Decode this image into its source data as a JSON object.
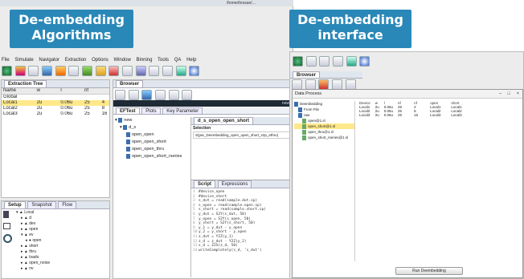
{
  "callouts": {
    "algorithms": "De-embedding\nAlgorithms",
    "interface": "De-embedding\ninterface"
  },
  "window": {
    "title_path": "/home/tnosan/..."
  },
  "menubar": [
    "File",
    "Simulate",
    "Navigator",
    "Extraction",
    "Options",
    "Window",
    "Binning",
    "Tools",
    "QA",
    "Help"
  ],
  "extraction_tree": {
    "tab": "Extraction Tree",
    "columns": [
      "Name",
      "w",
      "l",
      "nf"
    ],
    "rows": [
      [
        "Global",
        "",
        "",
        ""
      ],
      [
        "Local1",
        "2u",
        "0.06u",
        "25"
      ],
      [
        "Local2",
        "2u",
        "0.06u",
        "25"
      ],
      [
        "Local3",
        "2u",
        "0.06u",
        "25"
      ]
    ],
    "extra": [
      "4",
      "8",
      "16"
    ]
  },
  "browser": {
    "tab": "Browser",
    "subtabs": [
      "EFTest",
      "Plots",
      "Key Parameter"
    ],
    "new_label": "new",
    "tree_root": "new",
    "tree_folder": "d_s",
    "tree_items": [
      "open_open",
      "open_open_short",
      "open_open_thru",
      "open_open_short_rseries"
    ],
    "editor_tab": "d_s_open_open_short",
    "selection_label": "Selection",
    "selection_value": "S(par_Deembedding_open_open_short_s2p_ethru)"
  },
  "script": {
    "tabs": [
      "Script",
      "Expressions"
    ],
    "lines": [
      "#device_open",
      "#device_short",
      "s_dut = read(sample.dut.sp)",
      "s_open = read(sample.open.sp)",
      "s_short = read(sample.short.sp)",
      "y_dut = S2Y(s_dut, 50)",
      "y_open = S2Y(s_open, 50)",
      "y_short = S2Y(s_short, 50)",
      "y_1 = y_dut - y_open",
      "y_2 = y_short - y_open",
      "z_dut = Y2Z(y_1)",
      "z_d = z_dut - Y2Z(y_2)",
      "s_d = Z2S(z_d, 50)",
      "writeCompletely(s_d, 's_dut')"
    ]
  },
  "bottom_left": {
    "tabs": [
      "Setup",
      "Snapshot",
      "Flow"
    ],
    "tree": [
      "Local",
      "d",
      "dev",
      "open",
      "ev",
      "open",
      "short",
      "thru",
      "loads",
      "open_noise",
      "nv"
    ]
  },
  "right_app": {
    "browser_tab": "Browser",
    "dialog_title": "Data Process",
    "dialog_controls": [
      "–",
      "□",
      "×"
    ],
    "tree": {
      "root": "Deembedding",
      "items": [
        "From File",
        "raw",
        "open@1.sl",
        "open_short@1.sl",
        "open_thru@1.sl",
        "open_short_rseries@1.sl"
      ]
    },
    "table": {
      "columns": [
        "Device",
        "w",
        "l",
        "nf",
        "nf",
        "open",
        "short"
      ],
      "rows": [
        [
          "Local1",
          "2u",
          "0.06u",
          "25",
          "4",
          "Local1",
          "Local1"
        ],
        [
          "Local2",
          "2u",
          "0.06u",
          "25",
          "8",
          "Local2",
          "Local2"
        ],
        [
          "Local3",
          "2u",
          "0.06u",
          "25",
          "16",
          "Local3",
          "Local3"
        ]
      ]
    },
    "run_button": "Run Deembedding"
  }
}
